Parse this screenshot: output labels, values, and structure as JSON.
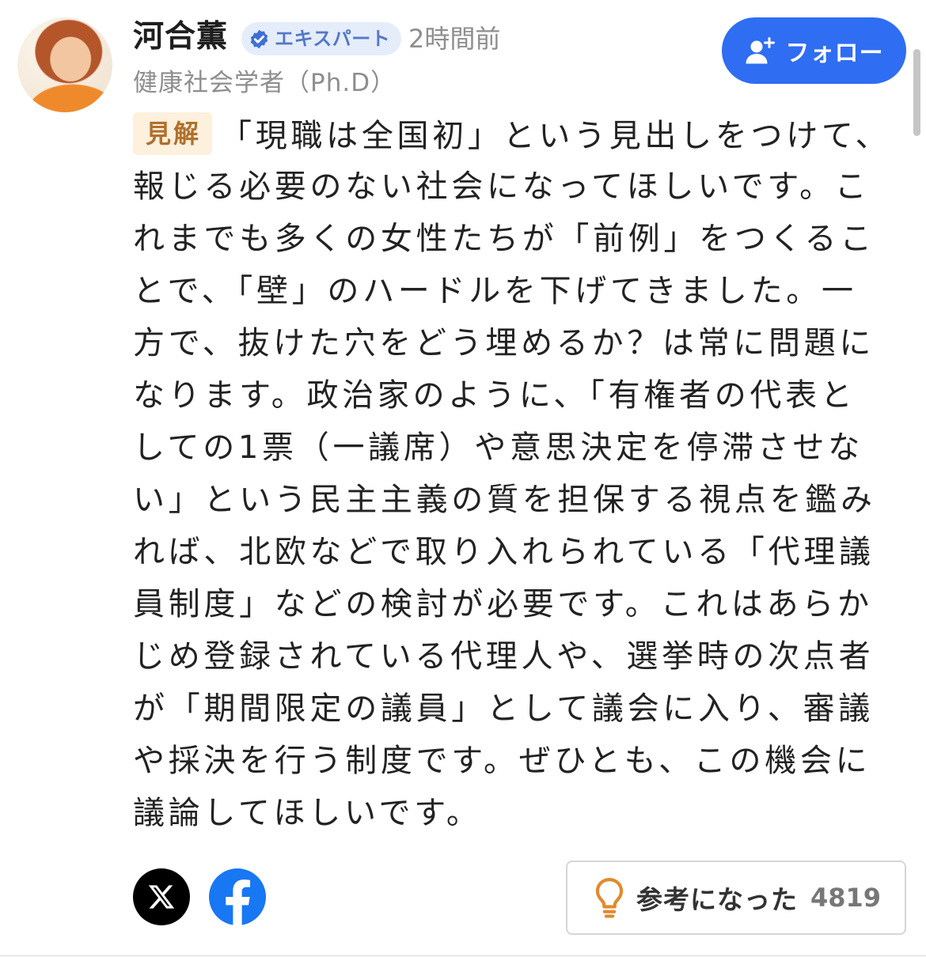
{
  "author": {
    "name": "河合薫",
    "badge_label": "エキスパート",
    "badge_icon": "verified-check-icon",
    "posted": "2時間前",
    "title": "健康社会学者（Ph.D）"
  },
  "follow_button": {
    "label": "フォロー",
    "icon": "person-add-icon"
  },
  "comment": {
    "tag": "見解",
    "lines": [
      "「現職は全国初」という見出しをつけて、",
      "報じる必要のない社会になってほしいです。こ",
      "れまでも多くの女性たちが「前例」をつくるこ",
      "とで、「壁」のハードルを下げてきました。一",
      "方で、抜けた穴をどう埋めるか？は常に問題に",
      "なります。政治家のように、「有権者の代表と",
      "しての1票（一議席）や意思決定を停滞させな",
      "い」という民主主義の質を担保する視点を鑑み",
      "れば、北欧などで取り入れられている「代理議",
      "員制度」などの検討が必要です。これはあらか",
      "じめ登録されている代理人や、選挙時の次点者",
      "が「期間限定の議員」として議会に入り、審議",
      "や採決を行う制度です。ぜひとも、この機会に",
      "議論してほしいです。"
    ]
  },
  "share": {
    "x_icon": "x-logo-icon",
    "facebook_icon": "facebook-logo-icon"
  },
  "helpful_button": {
    "label": "参考になった",
    "count": 4819,
    "icon": "lightbulb-icon"
  },
  "colors": {
    "accent": "#2f6df2",
    "expert_badge_bg": "#e5edfb",
    "expert_badge_text": "#5478c6",
    "expert_badge_icon": "#3f6fd6",
    "tag_bg": "#fdf0dd",
    "tag_text": "#b0712d",
    "bulb": "#e08a2e",
    "facebook": "#1877f2"
  }
}
